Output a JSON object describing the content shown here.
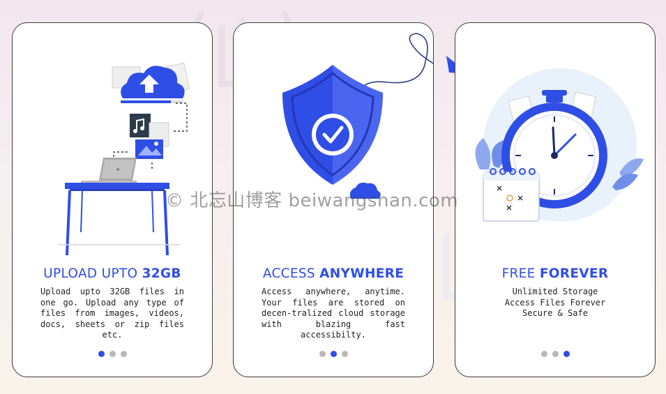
{
  "cards": [
    {
      "title_light": "UPLOAD UPTO ",
      "title_bold": "32GB",
      "description": "Upload upto 32GB files in one go. Upload any type of files from images, videos, docs, sheets or zip files etc.",
      "active_dot": 1
    },
    {
      "title_light": "ACCESS ",
      "title_bold": "ANYWHERE",
      "description": "Access anywhere, anytime. Your files are stored on decen-tralized cloud storage with blazing fast accessibilty.",
      "active_dot": 2
    },
    {
      "title_light": "FREE ",
      "title_bold": "FOREVER",
      "description_lines": [
        "Unlimited Storage",
        "Access Files Forever",
        "Secure & Safe"
      ],
      "active_dot": 3
    }
  ],
  "watermark": {
    "text": "© 北忘山博客 beiwangshan.com"
  },
  "colors": {
    "accent": "#2f4ee6",
    "dot_inactive": "#b8b8b8",
    "card_border": "#3a3a3a"
  },
  "icons": [
    "cloud-upload-icon",
    "laptop-icon",
    "shield-check-icon",
    "stopwatch-icon",
    "calendar-icon"
  ]
}
